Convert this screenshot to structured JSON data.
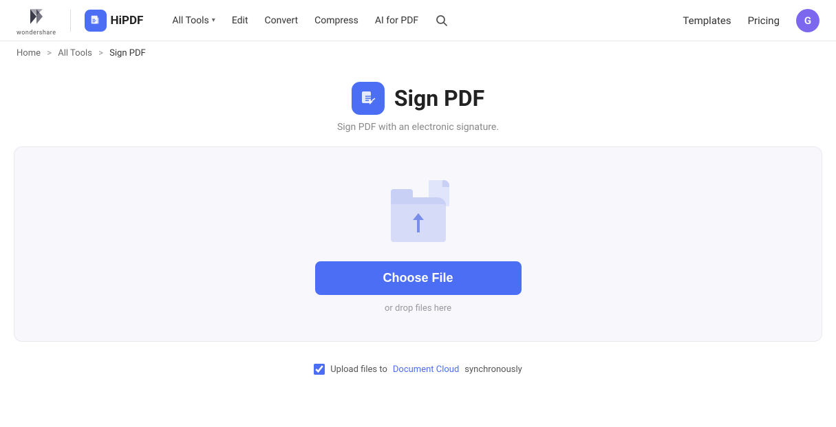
{
  "header": {
    "wondershare_text": "wondershare",
    "hipdf_label": "HiPDF",
    "nav": {
      "all_tools_label": "All Tools",
      "edit_label": "Edit",
      "convert_label": "Convert",
      "compress_label": "Compress",
      "ai_for_pdf_label": "AI for PDF"
    },
    "nav_right": {
      "templates_label": "Templates",
      "pricing_label": "Pricing",
      "avatar_letter": "G"
    }
  },
  "breadcrumb": {
    "home": "Home",
    "all_tools": "All Tools",
    "current": "Sign PDF",
    "sep1": ">",
    "sep2": ">"
  },
  "page": {
    "title": "Sign PDF",
    "subtitle": "Sign PDF with an electronic signature."
  },
  "upload": {
    "choose_file_label": "Choose File",
    "drop_text": "or drop files here",
    "checkbox_label_before": "Upload files to",
    "document_cloud_label": "Document Cloud",
    "checkbox_label_after": "synchronously"
  }
}
